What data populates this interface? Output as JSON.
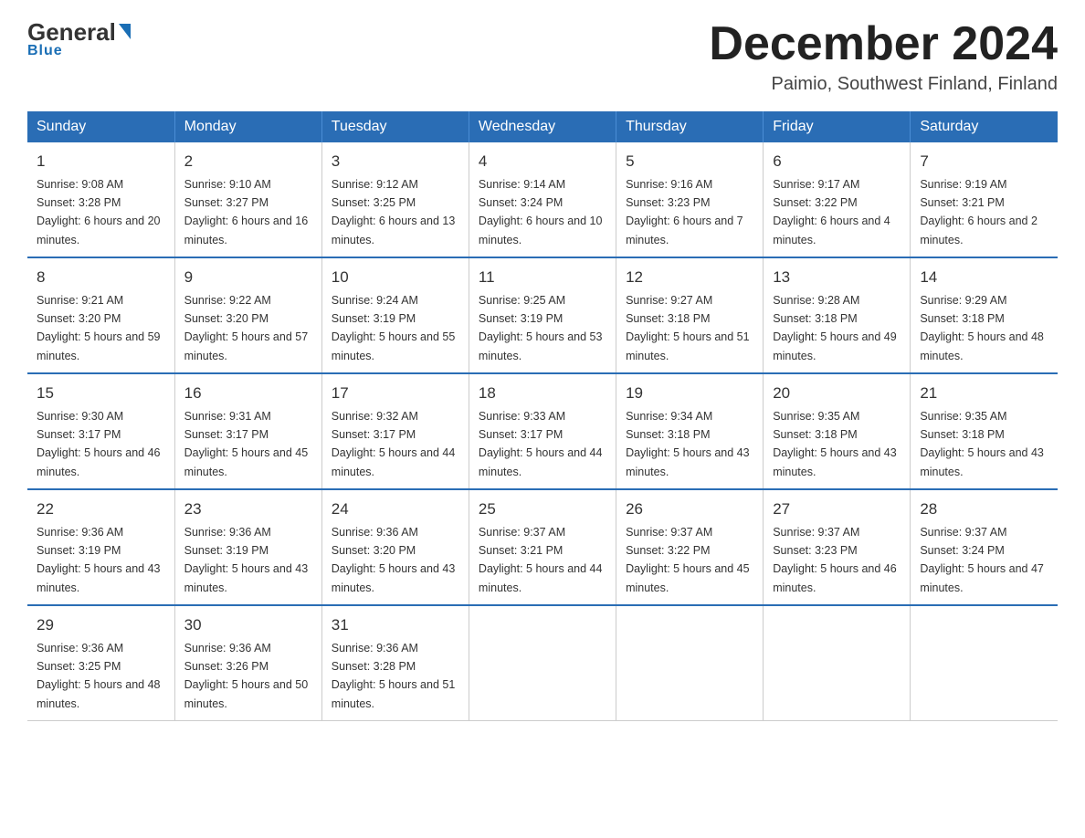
{
  "header": {
    "logo": {
      "general": "General",
      "blue": "Blue",
      "underline": "Blue"
    },
    "title": "December 2024",
    "location": "Paimio, Southwest Finland, Finland"
  },
  "weekdays": [
    "Sunday",
    "Monday",
    "Tuesday",
    "Wednesday",
    "Thursday",
    "Friday",
    "Saturday"
  ],
  "weeks": [
    [
      {
        "day": "1",
        "sunrise": "9:08 AM",
        "sunset": "3:28 PM",
        "daylight": "6 hours and 20 minutes."
      },
      {
        "day": "2",
        "sunrise": "9:10 AM",
        "sunset": "3:27 PM",
        "daylight": "6 hours and 16 minutes."
      },
      {
        "day": "3",
        "sunrise": "9:12 AM",
        "sunset": "3:25 PM",
        "daylight": "6 hours and 13 minutes."
      },
      {
        "day": "4",
        "sunrise": "9:14 AM",
        "sunset": "3:24 PM",
        "daylight": "6 hours and 10 minutes."
      },
      {
        "day": "5",
        "sunrise": "9:16 AM",
        "sunset": "3:23 PM",
        "daylight": "6 hours and 7 minutes."
      },
      {
        "day": "6",
        "sunrise": "9:17 AM",
        "sunset": "3:22 PM",
        "daylight": "6 hours and 4 minutes."
      },
      {
        "day": "7",
        "sunrise": "9:19 AM",
        "sunset": "3:21 PM",
        "daylight": "6 hours and 2 minutes."
      }
    ],
    [
      {
        "day": "8",
        "sunrise": "9:21 AM",
        "sunset": "3:20 PM",
        "daylight": "5 hours and 59 minutes."
      },
      {
        "day": "9",
        "sunrise": "9:22 AM",
        "sunset": "3:20 PM",
        "daylight": "5 hours and 57 minutes."
      },
      {
        "day": "10",
        "sunrise": "9:24 AM",
        "sunset": "3:19 PM",
        "daylight": "5 hours and 55 minutes."
      },
      {
        "day": "11",
        "sunrise": "9:25 AM",
        "sunset": "3:19 PM",
        "daylight": "5 hours and 53 minutes."
      },
      {
        "day": "12",
        "sunrise": "9:27 AM",
        "sunset": "3:18 PM",
        "daylight": "5 hours and 51 minutes."
      },
      {
        "day": "13",
        "sunrise": "9:28 AM",
        "sunset": "3:18 PM",
        "daylight": "5 hours and 49 minutes."
      },
      {
        "day": "14",
        "sunrise": "9:29 AM",
        "sunset": "3:18 PM",
        "daylight": "5 hours and 48 minutes."
      }
    ],
    [
      {
        "day": "15",
        "sunrise": "9:30 AM",
        "sunset": "3:17 PM",
        "daylight": "5 hours and 46 minutes."
      },
      {
        "day": "16",
        "sunrise": "9:31 AM",
        "sunset": "3:17 PM",
        "daylight": "5 hours and 45 minutes."
      },
      {
        "day": "17",
        "sunrise": "9:32 AM",
        "sunset": "3:17 PM",
        "daylight": "5 hours and 44 minutes."
      },
      {
        "day": "18",
        "sunrise": "9:33 AM",
        "sunset": "3:17 PM",
        "daylight": "5 hours and 44 minutes."
      },
      {
        "day": "19",
        "sunrise": "9:34 AM",
        "sunset": "3:18 PM",
        "daylight": "5 hours and 43 minutes."
      },
      {
        "day": "20",
        "sunrise": "9:35 AM",
        "sunset": "3:18 PM",
        "daylight": "5 hours and 43 minutes."
      },
      {
        "day": "21",
        "sunrise": "9:35 AM",
        "sunset": "3:18 PM",
        "daylight": "5 hours and 43 minutes."
      }
    ],
    [
      {
        "day": "22",
        "sunrise": "9:36 AM",
        "sunset": "3:19 PM",
        "daylight": "5 hours and 43 minutes."
      },
      {
        "day": "23",
        "sunrise": "9:36 AM",
        "sunset": "3:19 PM",
        "daylight": "5 hours and 43 minutes."
      },
      {
        "day": "24",
        "sunrise": "9:36 AM",
        "sunset": "3:20 PM",
        "daylight": "5 hours and 43 minutes."
      },
      {
        "day": "25",
        "sunrise": "9:37 AM",
        "sunset": "3:21 PM",
        "daylight": "5 hours and 44 minutes."
      },
      {
        "day": "26",
        "sunrise": "9:37 AM",
        "sunset": "3:22 PM",
        "daylight": "5 hours and 45 minutes."
      },
      {
        "day": "27",
        "sunrise": "9:37 AM",
        "sunset": "3:23 PM",
        "daylight": "5 hours and 46 minutes."
      },
      {
        "day": "28",
        "sunrise": "9:37 AM",
        "sunset": "3:24 PM",
        "daylight": "5 hours and 47 minutes."
      }
    ],
    [
      {
        "day": "29",
        "sunrise": "9:36 AM",
        "sunset": "3:25 PM",
        "daylight": "5 hours and 48 minutes."
      },
      {
        "day": "30",
        "sunrise": "9:36 AM",
        "sunset": "3:26 PM",
        "daylight": "5 hours and 50 minutes."
      },
      {
        "day": "31",
        "sunrise": "9:36 AM",
        "sunset": "3:28 PM",
        "daylight": "5 hours and 51 minutes."
      },
      null,
      null,
      null,
      null
    ]
  ],
  "labels": {
    "sunrise": "Sunrise:",
    "sunset": "Sunset:",
    "daylight": "Daylight:"
  }
}
